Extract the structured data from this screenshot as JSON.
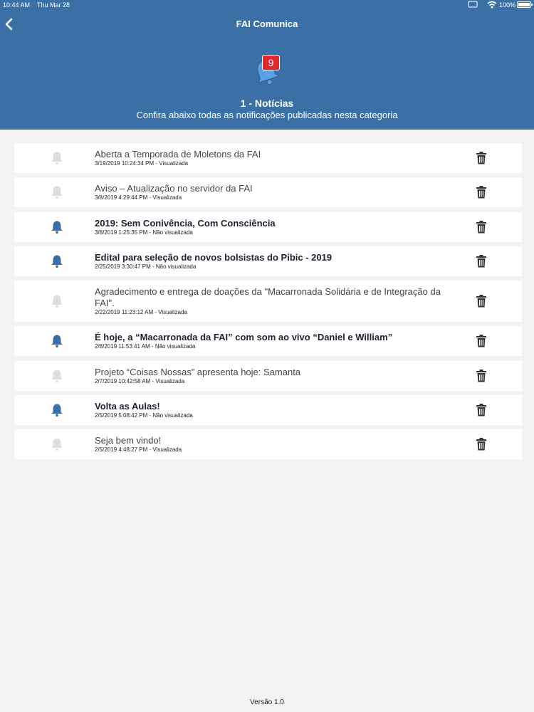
{
  "status_bar": {
    "time": "10:44 AM",
    "date": "Thu Mar 28",
    "battery": "100%"
  },
  "header": {
    "nav_title": "FAI Comunica",
    "badge_count": "9",
    "category_title": "1 - Notícias",
    "category_subtitle": "Confira abaixo todas as notificações publicadas nesta categoria"
  },
  "colors": {
    "header_bg": "#3b70a6",
    "bell_unread": "#3b70a6",
    "bell_read": "#dcdde0",
    "badge": "#e3262b"
  },
  "notifications": [
    {
      "title": "Aberta a Temporada de Moletons da FAI",
      "date": "3/19/2019 10:24:34 PM",
      "status": "Visualizada",
      "read": true
    },
    {
      "title": "Aviso – Atualização no servidor da FAI",
      "date": "3/8/2019 4:29:44 PM",
      "status": "Visualizada",
      "read": true
    },
    {
      "title": "2019: Sem Conivência, Com Consciência",
      "date": "3/8/2019 1:25:35 PM",
      "status": "Não visualizada",
      "read": false
    },
    {
      "title": "Edital para seleção de novos bolsistas do Pibic - 2019",
      "date": "2/25/2019 3:30:47 PM",
      "status": "Não visualizada",
      "read": false
    },
    {
      "title": "Agradecimento e entrega de doações da \"Macarronada Solidária e de Integração da FAI\".",
      "date": "2/22/2019 11:23:12 AM",
      "status": "Visualizada",
      "read": true
    },
    {
      "title": "É hoje, a “Macarronada da FAI” com som ao vivo “Daniel e William”",
      "date": "2/8/2019 11:53:41 AM",
      "status": "Não visualizada",
      "read": false
    },
    {
      "title": "Projeto “Coisas Nossas” apresenta hoje: Samanta",
      "date": "2/7/2019 10:42:58 AM",
      "status": "Visualizada",
      "read": true
    },
    {
      "title": "Volta as Aulas!",
      "date": "2/5/2019 5:08:42 PM",
      "status": "Não visualizada",
      "read": false
    },
    {
      "title": "Seja bem vindo!",
      "date": "2/5/2019 4:48:27 PM",
      "status": "Visualizada",
      "read": true
    }
  ],
  "footer": {
    "version": "Versão 1.0"
  },
  "icons": {
    "back": "chevron-left-icon",
    "notification": "bell-icon",
    "delete": "trash-icon"
  }
}
